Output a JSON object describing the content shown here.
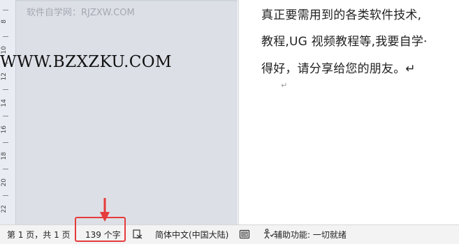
{
  "watermarks": {
    "top": "软件自学网：RJZXW.COM",
    "large": "WWW.BZXZKU.COM"
  },
  "ruler": {
    "labels": [
      "8",
      "10",
      "12",
      "14",
      "16",
      "18",
      "20",
      "22"
    ]
  },
  "document": {
    "lines": [
      "真正要需用到的各类软件技术,",
      "教程,UG  视频教程等,我要自学·",
      "得好，请分享给您的朋友。↵"
    ],
    "paragraph_mark": "↵"
  },
  "status_bar": {
    "pages": "第 1 页，共 1 页",
    "words": "139 个字",
    "language": "简体中文(中国大陆)",
    "accessibility": "辅助功能: 一切就绪"
  },
  "colors": {
    "highlight": "#e63b3b",
    "margin_gray": "#dcdfe6",
    "ruler_bg": "#e9ecf3",
    "statusbar_bg": "#f3f3f3"
  },
  "icons": [
    "proofing-icon",
    "focus-mode-icon",
    "accessibility-icon",
    "red-arrow-icon"
  ]
}
